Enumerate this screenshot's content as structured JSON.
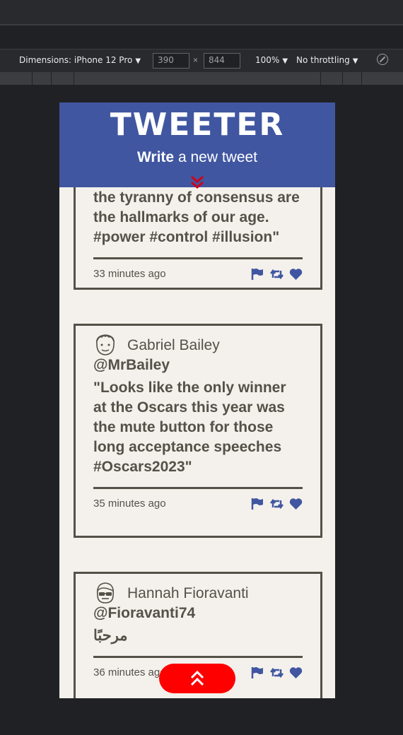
{
  "devtools": {
    "dimensions_label": "Dimensions: iPhone 12 Pro",
    "width": "390",
    "height": "844",
    "zoom": "100%",
    "throttling": "No throttling"
  },
  "header": {
    "logo": "TWEETER",
    "write_bold": "Write",
    "write_rest": " a new tweet"
  },
  "tweets": [
    {
      "content": "the tyranny of consensus are the hallmarks of our age. #power #control #illusion\"",
      "time": "33 minutes ago"
    },
    {
      "name": "Gabriel Bailey",
      "handle": "@MrBailey",
      "content": "\"Looks like the only winner at the Oscars this year was the mute button for those long acceptance speeches #Oscars2023\"",
      "time": "35 minutes ago"
    },
    {
      "name": "Hannah Fioravanti",
      "handle": "@Fioravanti74",
      "content": "مرحبًا",
      "time": "36 minutes ago"
    }
  ],
  "icons": [
    "flag-icon",
    "retweet-icon",
    "heart-icon"
  ],
  "colors": {
    "header_bg": "#4056a1",
    "page_bg": "#f4f1ec",
    "text": "#545149",
    "accent_red": "#ff0000"
  }
}
